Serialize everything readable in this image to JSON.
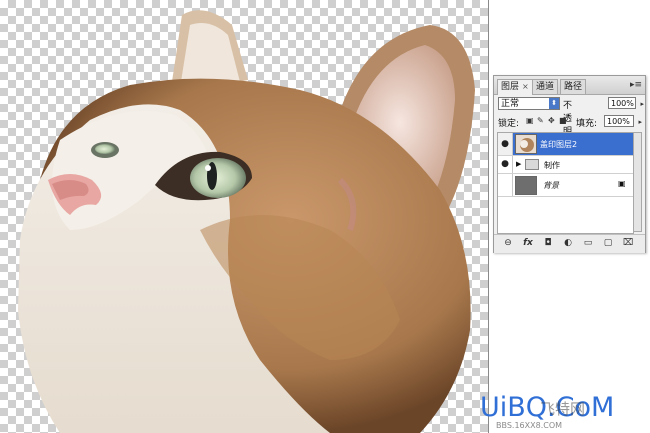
{
  "layers_panel": {
    "tabs": [
      {
        "label": "图层",
        "close": "×"
      },
      {
        "label": "通道"
      },
      {
        "label": "路径"
      }
    ],
    "menu_icon": "panel-menu-icon",
    "blend_mode": "正常",
    "opacity_label": "不透明度:",
    "opacity_value": "100%",
    "lock_label": "锁定:",
    "fill_label": "填充:",
    "fill_value": "100%",
    "layers": [
      {
        "name": "盖印图层2",
        "selected": true,
        "visible": true
      },
      {
        "name": "制作",
        "type": "group",
        "visible": true
      },
      {
        "name": "背景",
        "locked": true,
        "visible": false
      }
    ]
  },
  "watermark": {
    "logo": "UiBQ.CoM",
    "chinese": "飞特网",
    "url": "BBS.16XX8.COM"
  },
  "colors": {
    "selection": "#3a6ecf",
    "panel_bg": "#f0f0f0",
    "logo_blue": "#2f6fd6"
  }
}
